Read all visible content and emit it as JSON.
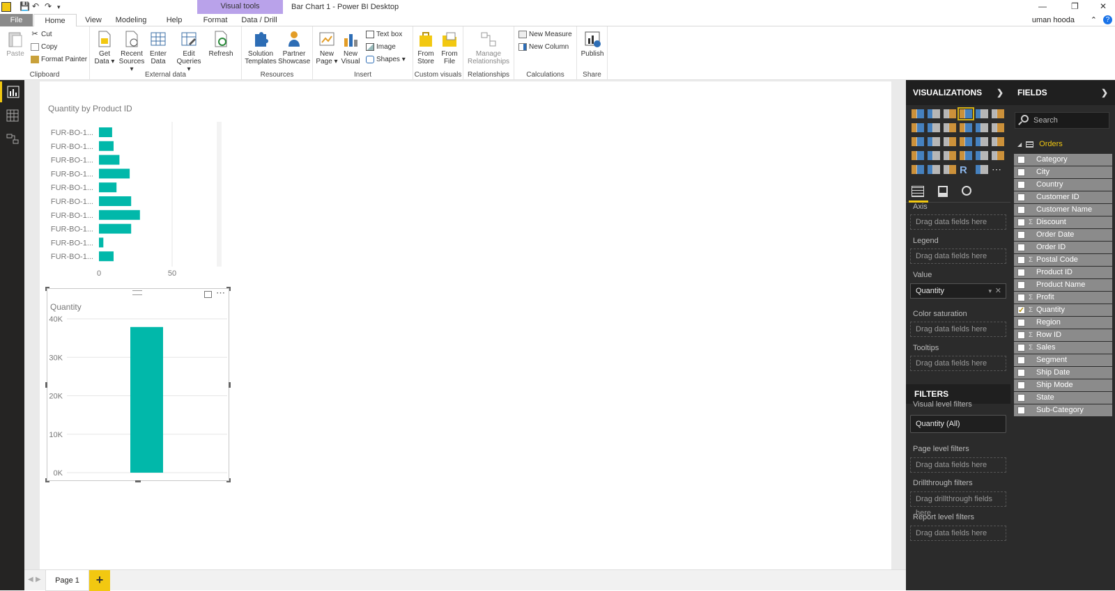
{
  "window": {
    "title": "Bar Chart 1 - Power BI Desktop",
    "context_tab": "Visual tools",
    "user": "uman hooda"
  },
  "tabs": [
    "File",
    "Home",
    "View",
    "Modeling",
    "Help",
    "Format",
    "Data / Drill"
  ],
  "ribbon": {
    "clipboard": {
      "label": "Clipboard",
      "paste": "Paste",
      "cut": "Cut",
      "copy": "Copy",
      "format_painter": "Format Painter"
    },
    "external": {
      "label": "External data",
      "get_data": [
        "Get",
        "Data ▾"
      ],
      "recent": [
        "Recent",
        "Sources ▾"
      ],
      "enter": [
        "Enter",
        "Data"
      ],
      "edit": [
        "Edit",
        "Queries ▾"
      ],
      "refresh": "Refresh"
    },
    "resources": {
      "label": "Resources",
      "solution": [
        "Solution",
        "Templates"
      ],
      "partner": [
        "Partner",
        "Showcase"
      ]
    },
    "insert": {
      "label": "Insert",
      "new_page": [
        "New",
        "Page ▾"
      ],
      "new_visual": [
        "New",
        "Visual"
      ],
      "text_box": "Text box",
      "image": "Image",
      "shapes": "Shapes ▾"
    },
    "custom": {
      "label": "Custom visuals",
      "from_store": [
        "From",
        "Store"
      ],
      "from_file": [
        "From",
        "File"
      ]
    },
    "relationships": {
      "label": "Relationships",
      "manage": [
        "Manage",
        "Relationships"
      ]
    },
    "calculations": {
      "label": "Calculations",
      "new_measure": "New Measure",
      "new_column": "New Column"
    },
    "share": {
      "label": "Share",
      "publish": "Publish"
    }
  },
  "page_tab": "Page 1",
  "chart_data": [
    {
      "type": "bar",
      "orientation": "horizontal",
      "title": "Quantity by Product ID",
      "categories": [
        "FUR-BO-1...",
        "FUR-BO-1...",
        "FUR-BO-1...",
        "FUR-BO-1...",
        "FUR-BO-1...",
        "FUR-BO-1...",
        "FUR-BO-1...",
        "FUR-BO-1...",
        "FUR-BO-1...",
        "FUR-BO-1..."
      ],
      "values": [
        9,
        10,
        14,
        21,
        12,
        22,
        28,
        22,
        3,
        10
      ],
      "xlim": [
        0,
        60
      ],
      "xticks": [
        "0",
        "50"
      ],
      "grid": true
    },
    {
      "type": "bar",
      "title": "Quantity",
      "categories": [
        ""
      ],
      "values": [
        37873
      ],
      "ylim": [
        0,
        40000
      ],
      "yticks": [
        "0K",
        "10K",
        "20K",
        "30K",
        "40K"
      ],
      "grid": true
    }
  ],
  "visualizations": {
    "header": "VISUALIZATIONS",
    "wells": [
      {
        "label": "Axis",
        "placeholder": "Drag data fields here"
      },
      {
        "label": "Legend",
        "placeholder": "Drag data fields here"
      },
      {
        "label": "Value",
        "value": "Quantity"
      },
      {
        "label": "Color saturation",
        "placeholder": "Drag data fields here"
      },
      {
        "label": "Tooltips",
        "placeholder": "Drag data fields here"
      }
    ]
  },
  "filters": {
    "header": "FILTERS",
    "visual_label": "Visual level filters",
    "visual_value": "Quantity (All)",
    "page_label": "Page level filters",
    "page_placeholder": "Drag data fields here",
    "drill_label": "Drillthrough filters",
    "drill_placeholder": "Drag drillthrough fields here",
    "report_label": "Report level filters",
    "report_placeholder": "Drag data fields here"
  },
  "fields": {
    "header": "FIELDS",
    "search_placeholder": "Search",
    "table": "Orders",
    "items": [
      {
        "name": "Category",
        "sigma": false,
        "checked": false
      },
      {
        "name": "City",
        "sigma": false,
        "checked": false
      },
      {
        "name": "Country",
        "sigma": false,
        "checked": false
      },
      {
        "name": "Customer ID",
        "sigma": false,
        "checked": false
      },
      {
        "name": "Customer Name",
        "sigma": false,
        "checked": false
      },
      {
        "name": "Discount",
        "sigma": true,
        "checked": false
      },
      {
        "name": "Order Date",
        "sigma": false,
        "checked": false
      },
      {
        "name": "Order ID",
        "sigma": false,
        "checked": false
      },
      {
        "name": "Postal Code",
        "sigma": true,
        "checked": false
      },
      {
        "name": "Product ID",
        "sigma": false,
        "checked": false
      },
      {
        "name": "Product Name",
        "sigma": false,
        "checked": false
      },
      {
        "name": "Profit",
        "sigma": true,
        "checked": false
      },
      {
        "name": "Quantity",
        "sigma": true,
        "checked": true
      },
      {
        "name": "Region",
        "sigma": false,
        "checked": false
      },
      {
        "name": "Row ID",
        "sigma": true,
        "checked": false
      },
      {
        "name": "Sales",
        "sigma": true,
        "checked": false
      },
      {
        "name": "Segment",
        "sigma": false,
        "checked": false
      },
      {
        "name": "Ship Date",
        "sigma": false,
        "checked": false
      },
      {
        "name": "Ship Mode",
        "sigma": false,
        "checked": false
      },
      {
        "name": "State",
        "sigma": false,
        "checked": false
      },
      {
        "name": "Sub-Category",
        "sigma": false,
        "checked": false
      }
    ]
  },
  "colors": {
    "bar": "#01b8aa",
    "accent": "#f2c811",
    "pane": "#2b2b2b"
  }
}
